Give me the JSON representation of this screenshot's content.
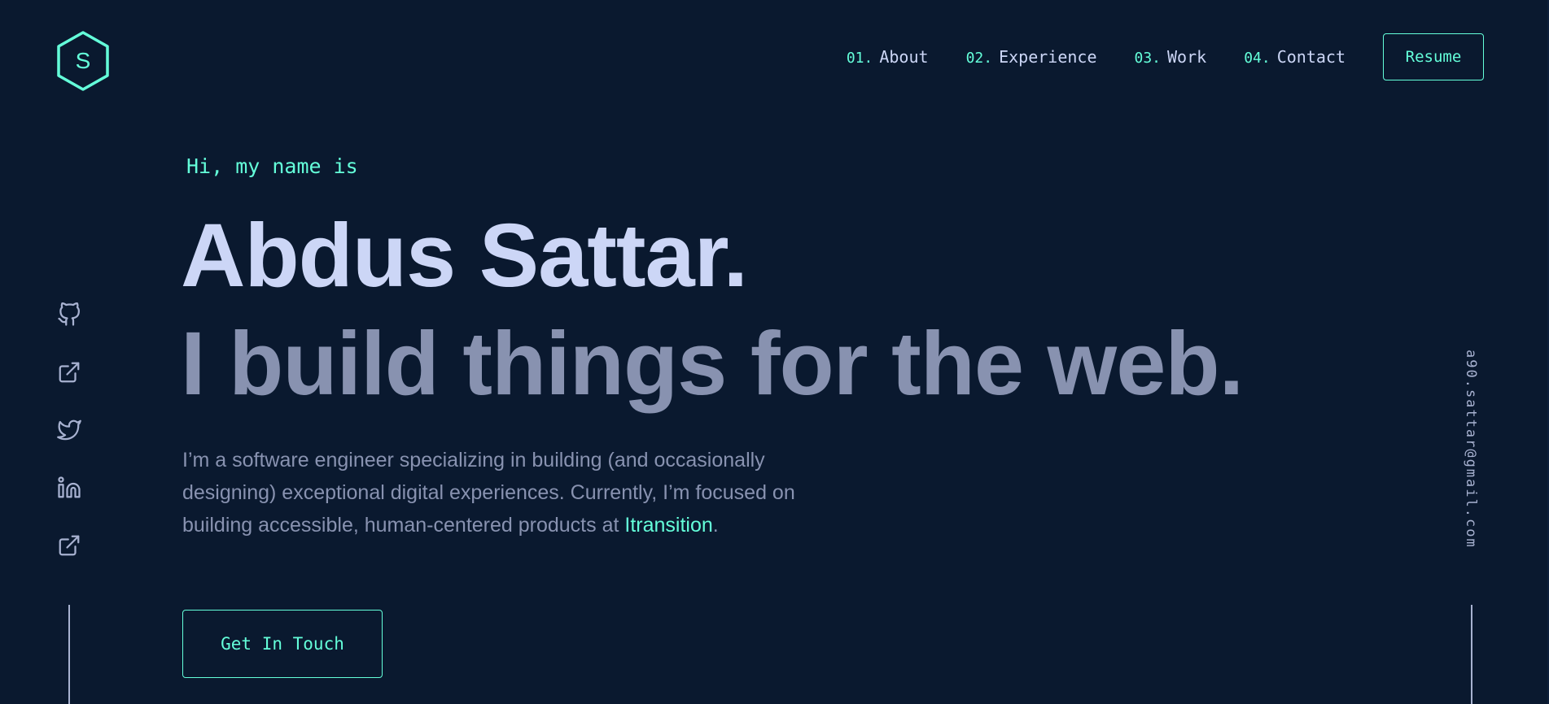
{
  "logo": {
    "letter": "S",
    "icon": "hexagon-logo-icon"
  },
  "nav": {
    "items": [
      {
        "num": "01.",
        "label": "About"
      },
      {
        "num": "02.",
        "label": "Experience"
      },
      {
        "num": "03.",
        "label": "Work"
      },
      {
        "num": "04.",
        "label": "Contact"
      }
    ],
    "resume_label": "Resume"
  },
  "hero": {
    "greeting": "Hi, my name is",
    "name": "Abdus Sattar.",
    "tagline": "I build things for the web.",
    "bio_prefix": "I’m a software engineer specializing in building (and occasionally designing) exceptional digital experiences. Currently, I’m focused on building accessible, human-centered products at ",
    "bio_link": "Itransition",
    "bio_suffix": ".",
    "cta_label": "Get In Touch"
  },
  "social": {
    "icons": [
      "github-icon",
      "external-link-icon",
      "twitter-icon",
      "linkedin-icon",
      "external-link-icon"
    ]
  },
  "email": "a90.sattar@gmail.com",
  "colors": {
    "background": "#0a192f",
    "accent": "#64ffda",
    "heading": "#ccd6f6",
    "text": "#8892b0",
    "light": "#a8b2d1"
  }
}
